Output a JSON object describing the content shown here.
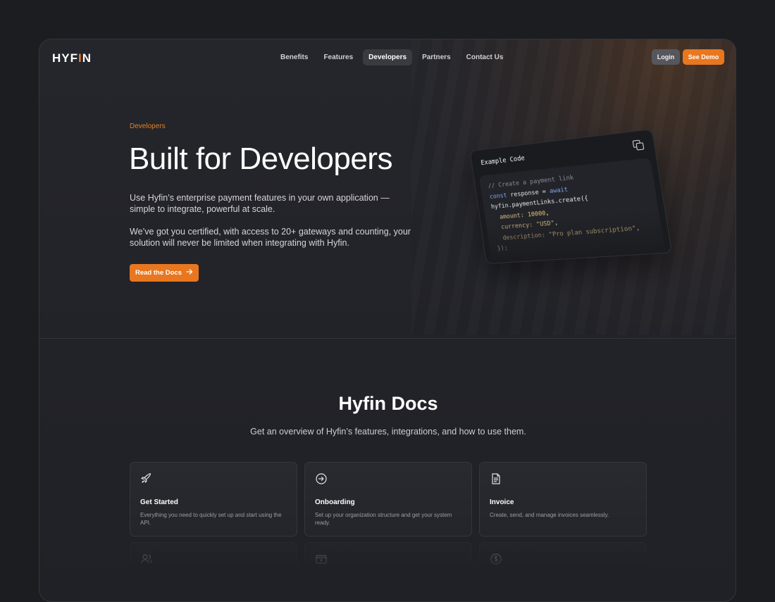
{
  "brand": {
    "name_main": "HYF",
    "name_accent": "I",
    "name_end": "N"
  },
  "nav": {
    "items": [
      {
        "label": "Benefits"
      },
      {
        "label": "Features"
      },
      {
        "label": "Developers"
      },
      {
        "label": "Partners"
      },
      {
        "label": "Contact Us"
      }
    ],
    "active": "Developers",
    "login_label": "Login",
    "demo_label": "See Demo"
  },
  "hero": {
    "eyebrow": "Developers",
    "title": "Built for Developers",
    "paragraph1": "Use Hyfin’s enterprise payment features in your own application — simple to integrate, powerful at scale.",
    "paragraph2": "We’ve got you certified, with access to 20+ gateways and counting, your solution will never be limited when integrating with Hyfin.",
    "cta_label": "Read the Docs",
    "cta_icon": "arrow-right-icon"
  },
  "code_card": {
    "title": "Example Code",
    "copy_icon": "copy-icon",
    "lines": {
      "l1": "// Create a payment link",
      "l2_kw": "const",
      "l2_var": " response = ",
      "l2_kw2": "await",
      "l3": "hyfin.paymentLinks.create({",
      "l4_key": "  amount: ",
      "l4_val": "10000",
      "l4_end": ",",
      "l5_key": "  currency: ",
      "l5_val": "\"USD\"",
      "l5_end": ",",
      "l6_key": "  description: ",
      "l6_val": "\"Pro plan subscription\"",
      "l6_end": ",",
      "l7": "});"
    }
  },
  "docs": {
    "title": "Hyfin Docs",
    "subtitle": "Get an overview of Hyfin’s features, integrations, and how to use them.",
    "cards": [
      {
        "icon": "rocket-icon",
        "title": "Get Started",
        "desc": "Everything you need to quickly set up and start using the API."
      },
      {
        "icon": "arrow-circle-icon",
        "title": "Onboarding",
        "desc": "Set up your organization structure and get your system ready."
      },
      {
        "icon": "document-icon",
        "title": "Invoice",
        "desc": "Create, send, and manage invoices seamlessly."
      }
    ],
    "ghost_cards": [
      {
        "icon": "users-icon"
      },
      {
        "icon": "payment-icon"
      },
      {
        "icon": "currency-icon"
      }
    ]
  },
  "colors": {
    "accent": "#e8771f",
    "background": "#1c1d21"
  }
}
